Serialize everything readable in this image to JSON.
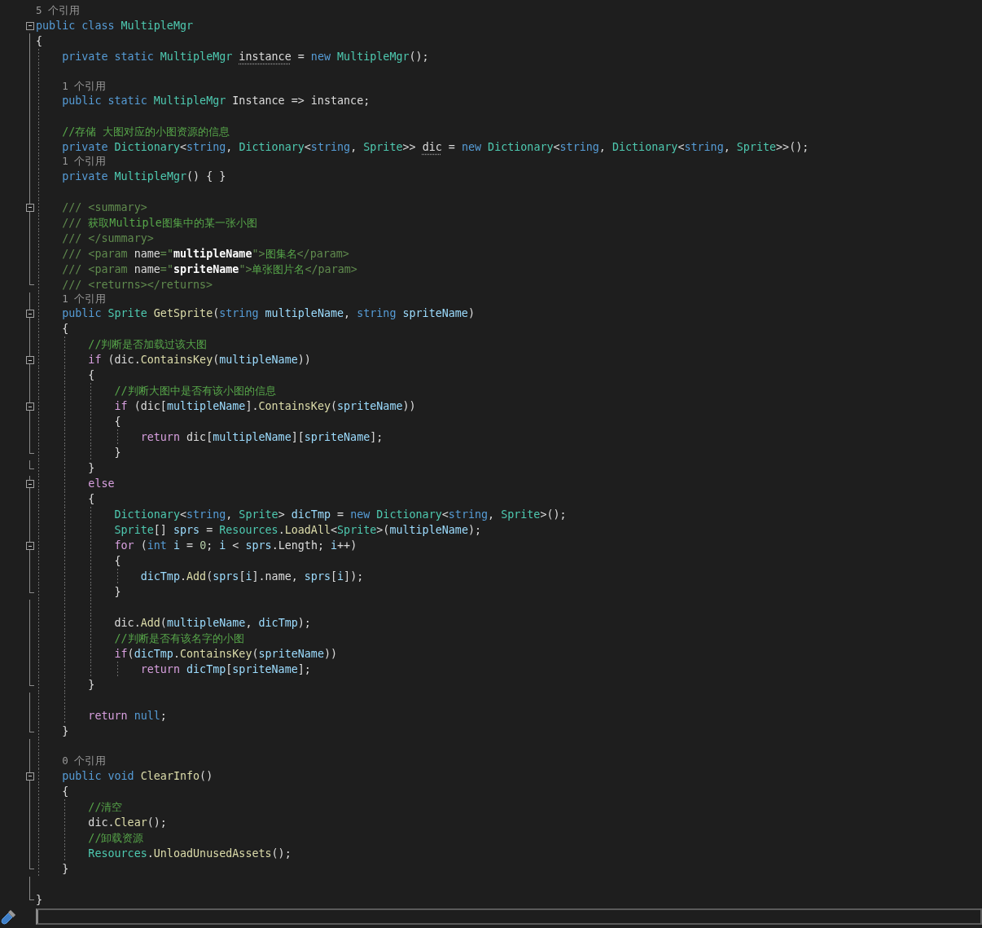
{
  "editor": {
    "lines": [
      {
        "kind": "codelens",
        "text": "5 个引用",
        "fold": false
      },
      {
        "kind": "code",
        "fold": true,
        "tokens": [
          {
            "text": "public class ",
            "kind": "keyword"
          },
          {
            "text": "MultipleMgr",
            "kind": "type"
          }
        ]
      },
      {
        "kind": "code",
        "fold": false,
        "tokens": [
          {
            "text": "{",
            "kind": "plain"
          }
        ]
      },
      {
        "kind": "code",
        "fold": false,
        "tokens": [
          {
            "text": "    private static ",
            "kind": "keyword"
          },
          {
            "text": "MultipleMgr ",
            "kind": "type"
          },
          {
            "text": "instance",
            "kind": "hinted"
          },
          {
            "text": " = ",
            "kind": "plain"
          },
          {
            "text": "new ",
            "kind": "keyword"
          },
          {
            "text": "MultipleMgr",
            "kind": "type"
          },
          {
            "text": "();",
            "kind": "plain"
          }
        ]
      },
      {
        "kind": "blank",
        "fold": false
      },
      {
        "kind": "codelens",
        "text": "    1 个引用",
        "fold": false
      },
      {
        "kind": "code",
        "fold": false,
        "tokens": [
          {
            "text": "    public static ",
            "kind": "keyword"
          },
          {
            "text": "MultipleMgr ",
            "kind": "type"
          },
          {
            "text": "Instance => instance;",
            "kind": "plain"
          }
        ]
      },
      {
        "kind": "blank",
        "fold": false
      },
      {
        "kind": "code",
        "fold": false,
        "tokens": [
          {
            "text": "    //存储 大图对应的小图资源的信息",
            "kind": "comment"
          }
        ]
      },
      {
        "kind": "code",
        "fold": false,
        "tokens": [
          {
            "text": "    private ",
            "kind": "keyword"
          },
          {
            "text": "Dictionary",
            "kind": "type"
          },
          {
            "text": "<",
            "kind": "plain"
          },
          {
            "text": "string",
            "kind": "keyword"
          },
          {
            "text": ", ",
            "kind": "plain"
          },
          {
            "text": "Dictionary",
            "kind": "type"
          },
          {
            "text": "<",
            "kind": "plain"
          },
          {
            "text": "string",
            "kind": "keyword"
          },
          {
            "text": ", ",
            "kind": "plain"
          },
          {
            "text": "Sprite",
            "kind": "type"
          },
          {
            "text": ">> ",
            "kind": "plain"
          },
          {
            "text": "dic",
            "kind": "hinted"
          },
          {
            "text": " = ",
            "kind": "plain"
          },
          {
            "text": "new ",
            "kind": "keyword"
          },
          {
            "text": "Dictionary",
            "kind": "type"
          },
          {
            "text": "<",
            "kind": "plain"
          },
          {
            "text": "string",
            "kind": "keyword"
          },
          {
            "text": ", ",
            "kind": "plain"
          },
          {
            "text": "Dictionary",
            "kind": "type"
          },
          {
            "text": "<",
            "kind": "plain"
          },
          {
            "text": "string",
            "kind": "keyword"
          },
          {
            "text": ", ",
            "kind": "plain"
          },
          {
            "text": "Sprite",
            "kind": "type"
          },
          {
            "text": ">>();",
            "kind": "plain"
          }
        ]
      },
      {
        "kind": "codelens",
        "text": "    1 个引用",
        "fold": false
      },
      {
        "kind": "code",
        "fold": false,
        "tokens": [
          {
            "text": "    private ",
            "kind": "keyword"
          },
          {
            "text": "MultipleMgr",
            "kind": "type"
          },
          {
            "text": "() { }",
            "kind": "plain"
          }
        ]
      },
      {
        "kind": "blank",
        "fold": false
      },
      {
        "kind": "code",
        "fold": true,
        "tokens": [
          {
            "text": "    /// <summary>",
            "kind": "doc"
          }
        ]
      },
      {
        "kind": "code",
        "fold": false,
        "tokens": [
          {
            "text": "    /// ",
            "kind": "doc"
          },
          {
            "text": "获取Multiple图集中的某一张小图",
            "kind": "comment"
          }
        ]
      },
      {
        "kind": "code",
        "fold": false,
        "tokens": [
          {
            "text": "    /// </summary>",
            "kind": "doc"
          }
        ]
      },
      {
        "kind": "code",
        "fold": false,
        "tokens": [
          {
            "text": "    /// <param ",
            "kind": "doc"
          },
          {
            "text": "name",
            "kind": "plain"
          },
          {
            "text": "=\"",
            "kind": "doc"
          },
          {
            "text": "multipleName",
            "kind": "doc_value"
          },
          {
            "text": "\">",
            "kind": "doc"
          },
          {
            "text": "图集名",
            "kind": "comment"
          },
          {
            "text": "</param>",
            "kind": "doc"
          }
        ]
      },
      {
        "kind": "code",
        "fold": false,
        "tokens": [
          {
            "text": "    /// <param ",
            "kind": "doc"
          },
          {
            "text": "name",
            "kind": "plain"
          },
          {
            "text": "=\"",
            "kind": "doc"
          },
          {
            "text": "spriteName",
            "kind": "doc_value"
          },
          {
            "text": "\">",
            "kind": "doc"
          },
          {
            "text": "单张图片名",
            "kind": "comment"
          },
          {
            "text": "</param>",
            "kind": "doc"
          }
        ]
      },
      {
        "kind": "code",
        "fold": false,
        "tokens": [
          {
            "text": "    /// <returns></returns>",
            "kind": "doc"
          }
        ]
      },
      {
        "kind": "codelens",
        "text": "    1 个引用",
        "fold": false
      },
      {
        "kind": "code",
        "fold": true,
        "tokens": [
          {
            "text": "    public ",
            "kind": "keyword"
          },
          {
            "text": "Sprite ",
            "kind": "type"
          },
          {
            "text": "GetSprite",
            "kind": "method"
          },
          {
            "text": "(",
            "kind": "plain"
          },
          {
            "text": "string ",
            "kind": "keyword"
          },
          {
            "text": "multipleName",
            "kind": "param"
          },
          {
            "text": ", ",
            "kind": "plain"
          },
          {
            "text": "string ",
            "kind": "keyword"
          },
          {
            "text": "spriteName",
            "kind": "param"
          },
          {
            "text": ")",
            "kind": "plain"
          }
        ]
      },
      {
        "kind": "code",
        "fold": false,
        "tokens": [
          {
            "text": "    {",
            "kind": "plain"
          }
        ]
      },
      {
        "kind": "code",
        "fold": false,
        "tokens": [
          {
            "text": "        //判断是否加载过该大图",
            "kind": "comment"
          }
        ]
      },
      {
        "kind": "code",
        "fold": true,
        "tokens": [
          {
            "text": "        if ",
            "kind": "control"
          },
          {
            "text": "(dic.",
            "kind": "plain"
          },
          {
            "text": "ContainsKey",
            "kind": "method"
          },
          {
            "text": "(",
            "kind": "plain"
          },
          {
            "text": "multipleName",
            "kind": "param"
          },
          {
            "text": "))",
            "kind": "plain"
          }
        ]
      },
      {
        "kind": "code",
        "fold": false,
        "tokens": [
          {
            "text": "        {",
            "kind": "plain"
          }
        ]
      },
      {
        "kind": "code",
        "fold": false,
        "tokens": [
          {
            "text": "            //判断大图中是否有该小图的信息",
            "kind": "comment"
          }
        ]
      },
      {
        "kind": "code",
        "fold": true,
        "tokens": [
          {
            "text": "            if ",
            "kind": "control"
          },
          {
            "text": "(dic[",
            "kind": "plain"
          },
          {
            "text": "multipleName",
            "kind": "param"
          },
          {
            "text": "].",
            "kind": "plain"
          },
          {
            "text": "ContainsKey",
            "kind": "method"
          },
          {
            "text": "(",
            "kind": "plain"
          },
          {
            "text": "spriteName",
            "kind": "param"
          },
          {
            "text": "))",
            "kind": "plain"
          }
        ]
      },
      {
        "kind": "code",
        "fold": false,
        "tokens": [
          {
            "text": "            {",
            "kind": "plain"
          }
        ]
      },
      {
        "kind": "code",
        "fold": false,
        "tokens": [
          {
            "text": "                return ",
            "kind": "control"
          },
          {
            "text": "dic[",
            "kind": "plain"
          },
          {
            "text": "multipleName",
            "kind": "param"
          },
          {
            "text": "][",
            "kind": "plain"
          },
          {
            "text": "spriteName",
            "kind": "param"
          },
          {
            "text": "];",
            "kind": "plain"
          }
        ]
      },
      {
        "kind": "code",
        "fold": false,
        "tokens": [
          {
            "text": "            }",
            "kind": "plain"
          }
        ]
      },
      {
        "kind": "code",
        "fold": false,
        "tokens": [
          {
            "text": "        }",
            "kind": "plain"
          }
        ]
      },
      {
        "kind": "code",
        "fold": true,
        "tokens": [
          {
            "text": "        else",
            "kind": "control"
          }
        ]
      },
      {
        "kind": "code",
        "fold": false,
        "tokens": [
          {
            "text": "        {",
            "kind": "plain"
          }
        ]
      },
      {
        "kind": "code",
        "fold": false,
        "tokens": [
          {
            "text": "            Dictionary",
            "kind": "type"
          },
          {
            "text": "<",
            "kind": "plain"
          },
          {
            "text": "string",
            "kind": "keyword"
          },
          {
            "text": ", ",
            "kind": "plain"
          },
          {
            "text": "Sprite",
            "kind": "type"
          },
          {
            "text": "> ",
            "kind": "plain"
          },
          {
            "text": "dicTmp",
            "kind": "local"
          },
          {
            "text": " = ",
            "kind": "plain"
          },
          {
            "text": "new ",
            "kind": "keyword"
          },
          {
            "text": "Dictionary",
            "kind": "type"
          },
          {
            "text": "<",
            "kind": "plain"
          },
          {
            "text": "string",
            "kind": "keyword"
          },
          {
            "text": ", ",
            "kind": "plain"
          },
          {
            "text": "Sprite",
            "kind": "type"
          },
          {
            "text": ">();",
            "kind": "plain"
          }
        ]
      },
      {
        "kind": "code",
        "fold": false,
        "tokens": [
          {
            "text": "            Sprite",
            "kind": "type"
          },
          {
            "text": "[] ",
            "kind": "plain"
          },
          {
            "text": "sprs",
            "kind": "local"
          },
          {
            "text": " = ",
            "kind": "plain"
          },
          {
            "text": "Resources",
            "kind": "type"
          },
          {
            "text": ".",
            "kind": "plain"
          },
          {
            "text": "LoadAll",
            "kind": "method"
          },
          {
            "text": "<",
            "kind": "plain"
          },
          {
            "text": "Sprite",
            "kind": "type"
          },
          {
            "text": ">(",
            "kind": "plain"
          },
          {
            "text": "multipleName",
            "kind": "param"
          },
          {
            "text": ");",
            "kind": "plain"
          }
        ]
      },
      {
        "kind": "code",
        "fold": true,
        "tokens": [
          {
            "text": "            for ",
            "kind": "control"
          },
          {
            "text": "(",
            "kind": "plain"
          },
          {
            "text": "int ",
            "kind": "keyword"
          },
          {
            "text": "i",
            "kind": "local"
          },
          {
            "text": " = ",
            "kind": "plain"
          },
          {
            "text": "0",
            "kind": "number"
          },
          {
            "text": "; ",
            "kind": "plain"
          },
          {
            "text": "i",
            "kind": "local"
          },
          {
            "text": " < ",
            "kind": "plain"
          },
          {
            "text": "sprs",
            "kind": "local"
          },
          {
            "text": ".Length; ",
            "kind": "plain"
          },
          {
            "text": "i",
            "kind": "local"
          },
          {
            "text": "++)",
            "kind": "plain"
          }
        ]
      },
      {
        "kind": "code",
        "fold": false,
        "tokens": [
          {
            "text": "            {",
            "kind": "plain"
          }
        ]
      },
      {
        "kind": "code",
        "fold": false,
        "tokens": [
          {
            "text": "                dicTmp",
            "kind": "local"
          },
          {
            "text": ".",
            "kind": "plain"
          },
          {
            "text": "Add",
            "kind": "method"
          },
          {
            "text": "(",
            "kind": "plain"
          },
          {
            "text": "sprs",
            "kind": "local"
          },
          {
            "text": "[",
            "kind": "plain"
          },
          {
            "text": "i",
            "kind": "local"
          },
          {
            "text": "].name, ",
            "kind": "plain"
          },
          {
            "text": "sprs",
            "kind": "local"
          },
          {
            "text": "[",
            "kind": "plain"
          },
          {
            "text": "i",
            "kind": "local"
          },
          {
            "text": "]);",
            "kind": "plain"
          }
        ]
      },
      {
        "kind": "code",
        "fold": false,
        "tokens": [
          {
            "text": "            }",
            "kind": "plain"
          }
        ]
      },
      {
        "kind": "blank",
        "fold": false
      },
      {
        "kind": "code",
        "fold": false,
        "tokens": [
          {
            "text": "            dic.",
            "kind": "plain"
          },
          {
            "text": "Add",
            "kind": "method"
          },
          {
            "text": "(",
            "kind": "plain"
          },
          {
            "text": "multipleName",
            "kind": "param"
          },
          {
            "text": ", ",
            "kind": "plain"
          },
          {
            "text": "dicTmp",
            "kind": "local"
          },
          {
            "text": ");",
            "kind": "plain"
          }
        ]
      },
      {
        "kind": "code",
        "fold": false,
        "tokens": [
          {
            "text": "            //判断是否有该名字的小图",
            "kind": "comment"
          }
        ]
      },
      {
        "kind": "code",
        "fold": false,
        "tokens": [
          {
            "text": "            if",
            "kind": "control"
          },
          {
            "text": "(",
            "kind": "plain"
          },
          {
            "text": "dicTmp",
            "kind": "local"
          },
          {
            "text": ".",
            "kind": "plain"
          },
          {
            "text": "ContainsKey",
            "kind": "method"
          },
          {
            "text": "(",
            "kind": "plain"
          },
          {
            "text": "spriteName",
            "kind": "param"
          },
          {
            "text": "))",
            "kind": "plain"
          }
        ]
      },
      {
        "kind": "code",
        "fold": false,
        "tokens": [
          {
            "text": "                return ",
            "kind": "control"
          },
          {
            "text": "dicTmp",
            "kind": "local"
          },
          {
            "text": "[",
            "kind": "plain"
          },
          {
            "text": "spriteName",
            "kind": "param"
          },
          {
            "text": "];",
            "kind": "plain"
          }
        ]
      },
      {
        "kind": "code",
        "fold": false,
        "tokens": [
          {
            "text": "        }",
            "kind": "plain"
          }
        ]
      },
      {
        "kind": "blank",
        "fold": false
      },
      {
        "kind": "code",
        "fold": false,
        "tokens": [
          {
            "text": "        return ",
            "kind": "control"
          },
          {
            "text": "null",
            "kind": "keyword"
          },
          {
            "text": ";",
            "kind": "plain"
          }
        ]
      },
      {
        "kind": "code",
        "fold": false,
        "tokens": [
          {
            "text": "    }",
            "kind": "plain"
          }
        ]
      },
      {
        "kind": "blank",
        "fold": false
      },
      {
        "kind": "codelens",
        "text": "    0 个引用",
        "fold": false
      },
      {
        "kind": "code",
        "fold": true,
        "tokens": [
          {
            "text": "    public void ",
            "kind": "keyword"
          },
          {
            "text": "ClearInfo",
            "kind": "method"
          },
          {
            "text": "()",
            "kind": "plain"
          }
        ]
      },
      {
        "kind": "code",
        "fold": false,
        "tokens": [
          {
            "text": "    {",
            "kind": "plain"
          }
        ]
      },
      {
        "kind": "code",
        "fold": false,
        "tokens": [
          {
            "text": "        //清空",
            "kind": "comment"
          }
        ]
      },
      {
        "kind": "code",
        "fold": false,
        "tokens": [
          {
            "text": "        dic.",
            "kind": "plain"
          },
          {
            "text": "Clear",
            "kind": "method"
          },
          {
            "text": "();",
            "kind": "plain"
          }
        ]
      },
      {
        "kind": "code",
        "fold": false,
        "tokens": [
          {
            "text": "        //卸载资源",
            "kind": "comment"
          }
        ]
      },
      {
        "kind": "code",
        "fold": false,
        "tokens": [
          {
            "text": "        Resources",
            "kind": "type"
          },
          {
            "text": ".",
            "kind": "plain"
          },
          {
            "text": "UnloadUnusedAssets",
            "kind": "method"
          },
          {
            "text": "();",
            "kind": "plain"
          }
        ]
      },
      {
        "kind": "code",
        "fold": false,
        "tokens": [
          {
            "text": "    }",
            "kind": "plain"
          }
        ]
      },
      {
        "kind": "blank",
        "fold": false
      },
      {
        "kind": "code",
        "fold": false,
        "tokens": [
          {
            "text": "}",
            "kind": "plain"
          }
        ]
      }
    ]
  }
}
